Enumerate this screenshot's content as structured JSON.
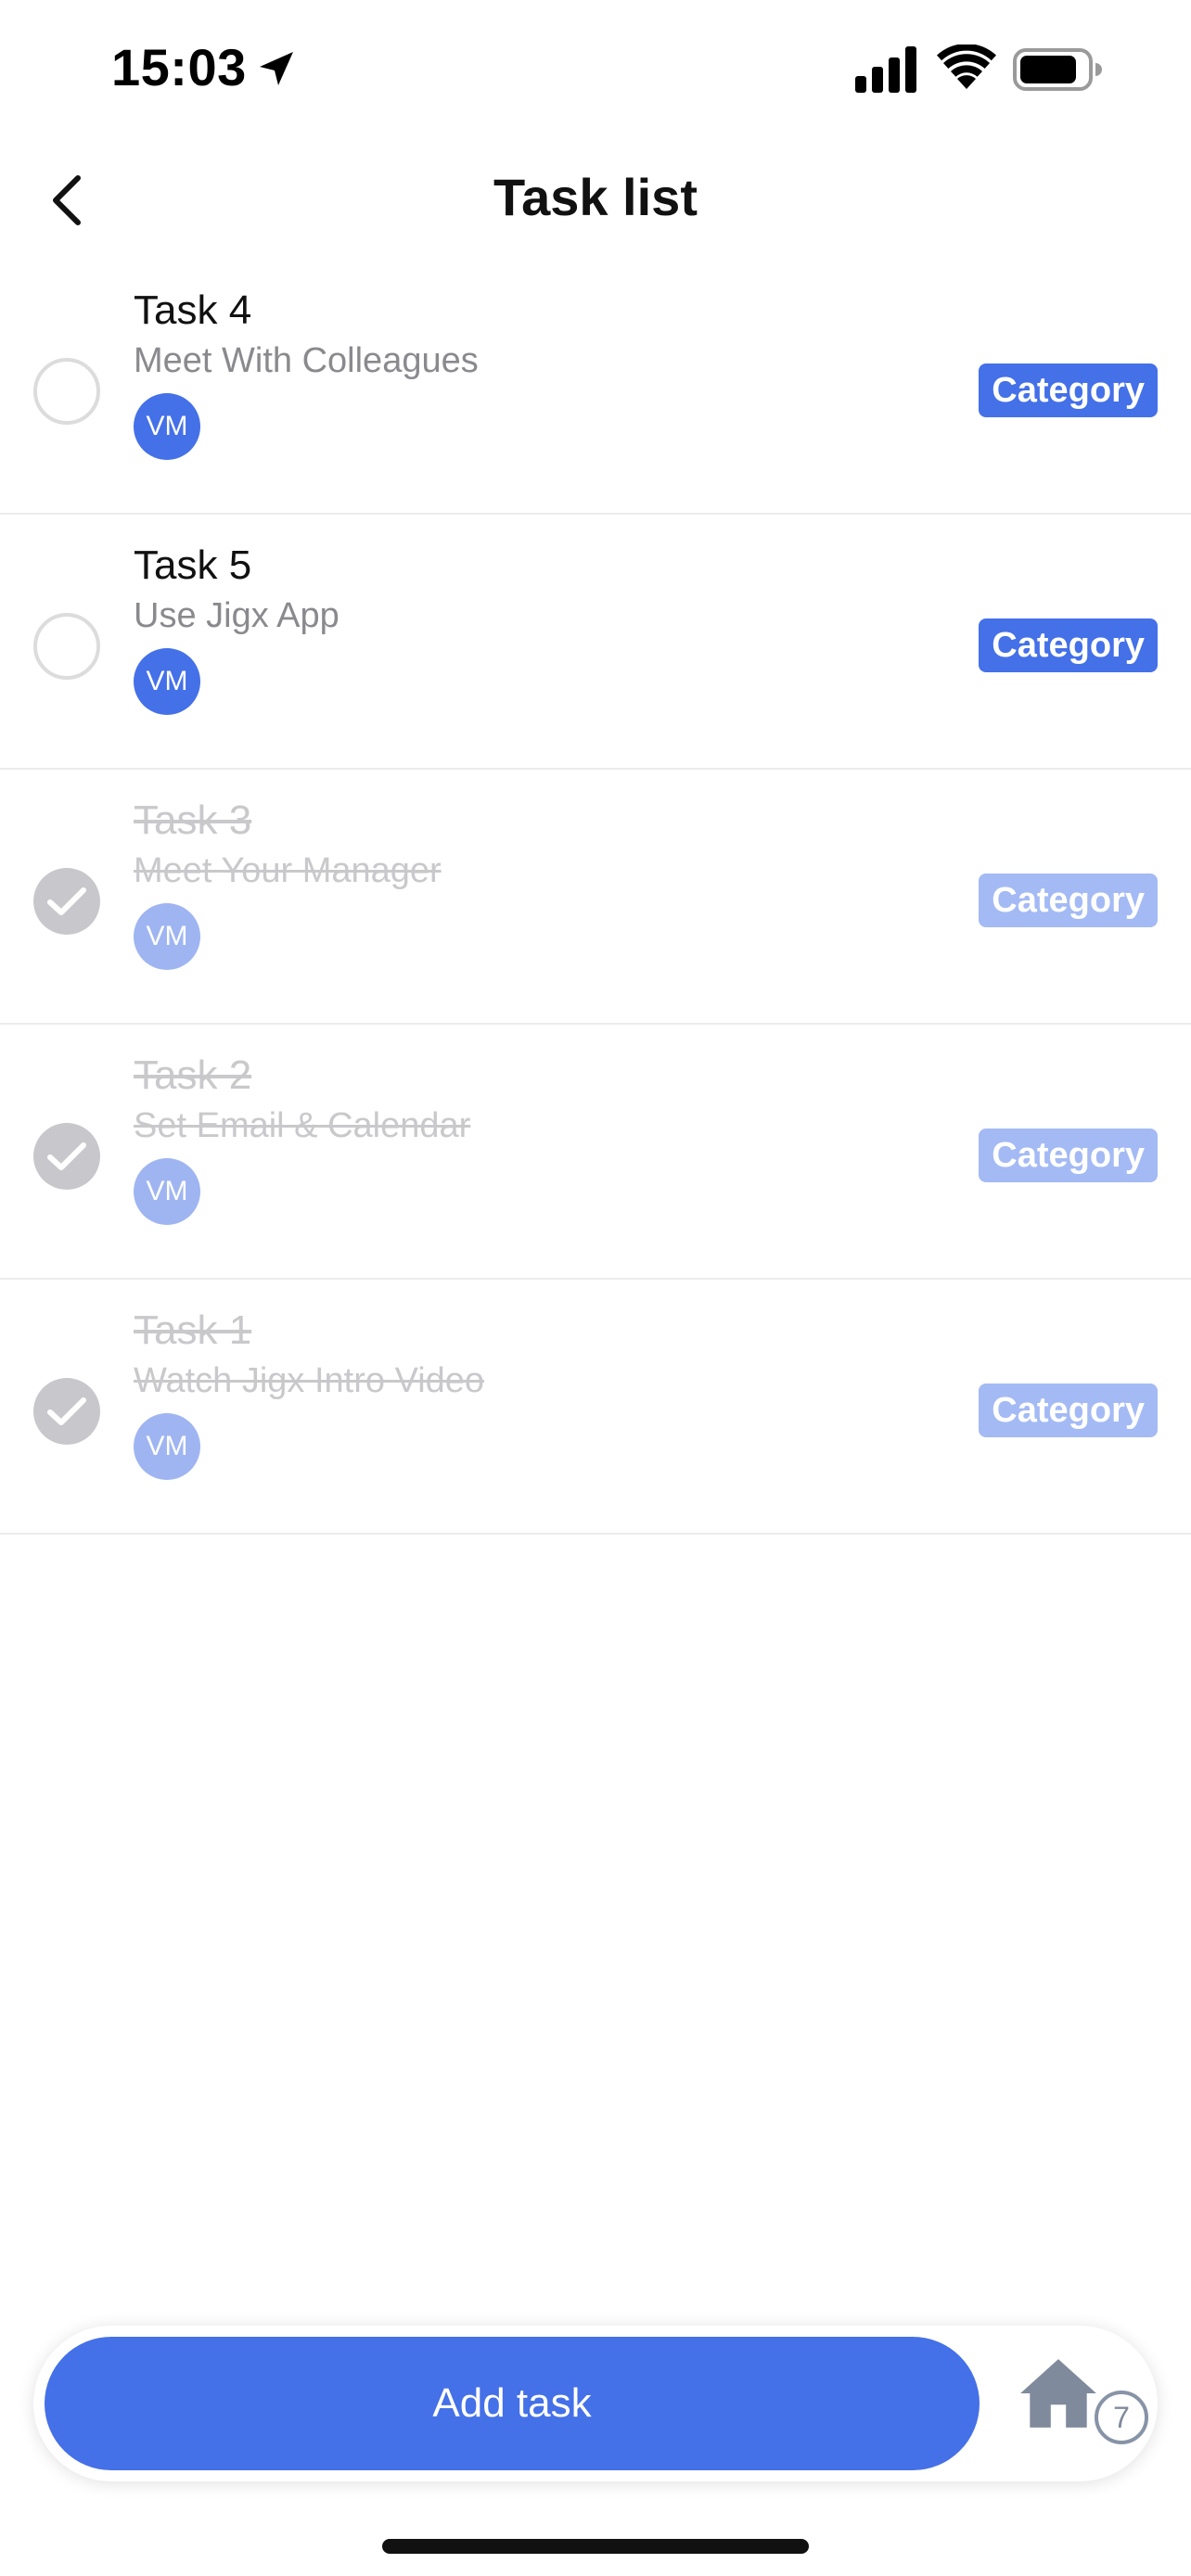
{
  "status_bar": {
    "time": "15:03"
  },
  "header": {
    "title": "Task list"
  },
  "tasks": [
    {
      "title": "Task 4",
      "subtitle": "Meet With Colleagues",
      "assignee_initials": "VM",
      "category": "Category",
      "completed": false
    },
    {
      "title": "Task 5",
      "subtitle": "Use Jigx App",
      "assignee_initials": "VM",
      "category": "Category",
      "completed": false
    },
    {
      "title": "Task 3",
      "subtitle": "Meet Your Manager",
      "assignee_initials": "VM",
      "category": "Category",
      "completed": true
    },
    {
      "title": "Task 2",
      "subtitle": "Set Email & Calendar",
      "assignee_initials": "VM",
      "category": "Category",
      "completed": true
    },
    {
      "title": "Task 1",
      "subtitle": "Watch Jigx Intro Video",
      "assignee_initials": "VM",
      "category": "Category",
      "completed": true
    }
  ],
  "bottom_bar": {
    "add_label": "Add task",
    "home_icon": "home-icon",
    "home_count": "7"
  },
  "colors": {
    "accent": "#4470e8",
    "accent_faded": "#a4baf4",
    "check_done": "#c8c8cc"
  }
}
